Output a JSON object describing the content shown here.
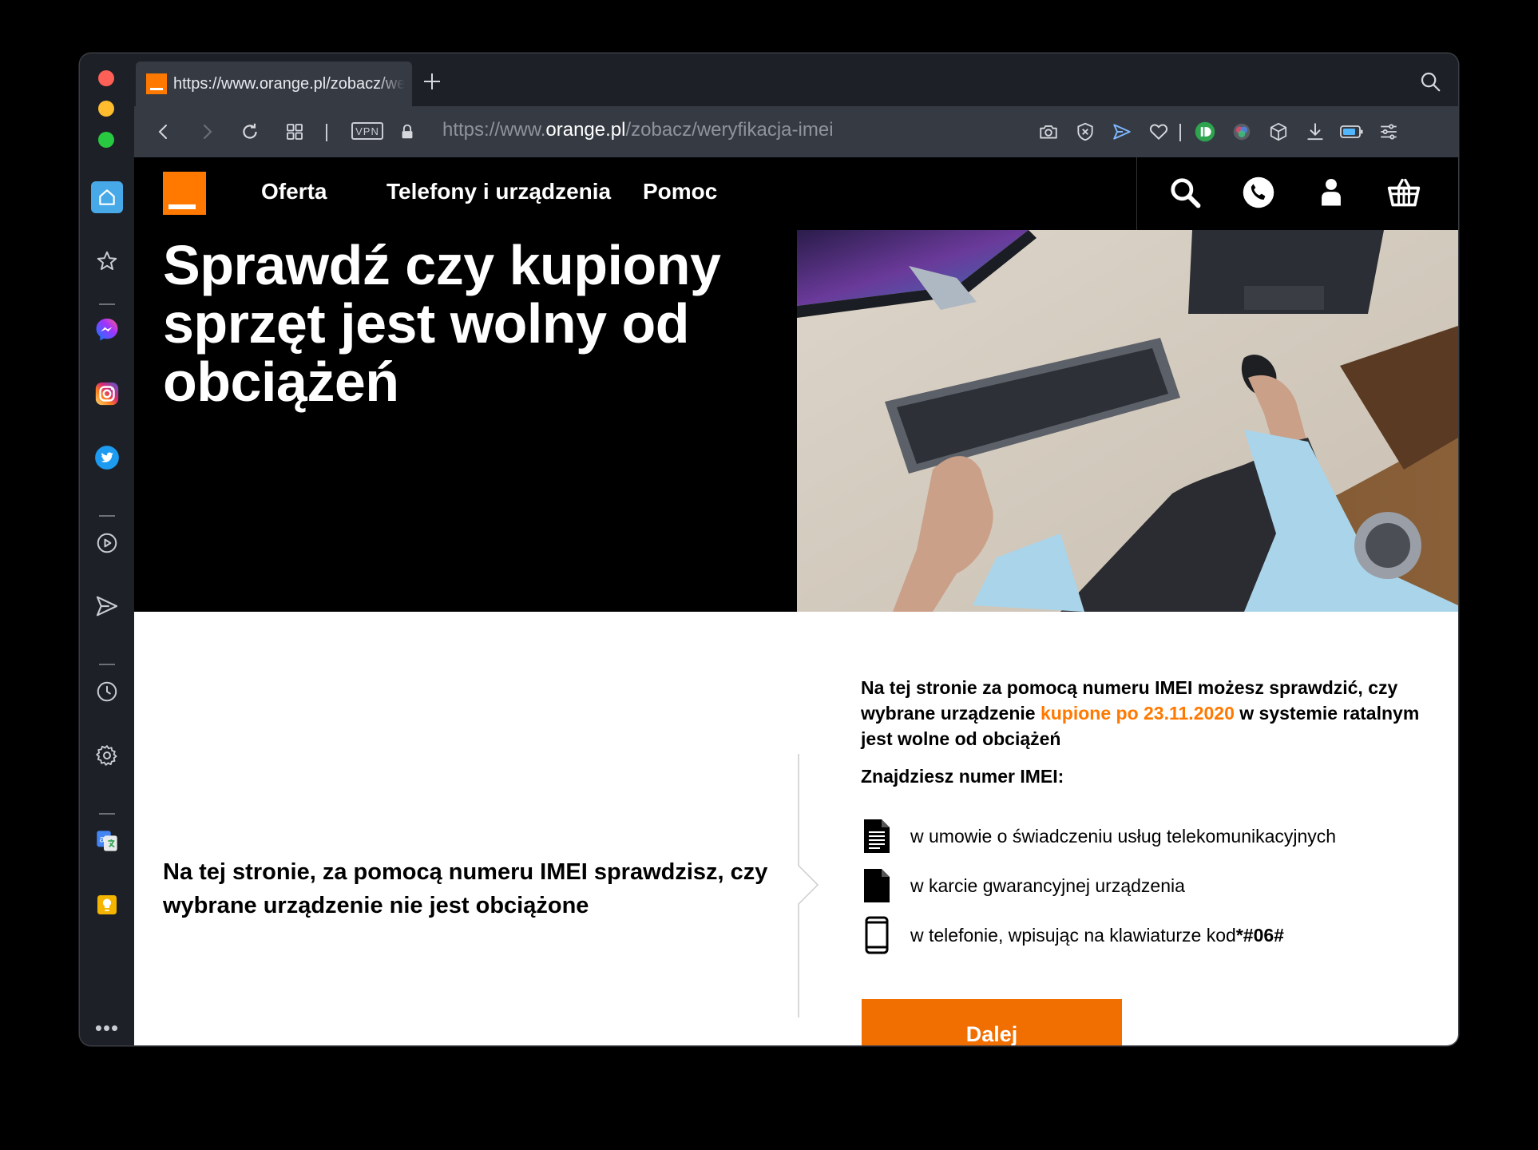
{
  "browser": {
    "tab_title": "https://www.orange.pl/zobacz/weryfikacja-imei",
    "url_prefix": "https://www.",
    "url_host": "orange.pl",
    "url_path": "/zobacz/weryfikacja-imei",
    "vpn_label": "VPN"
  },
  "nav": {
    "links": [
      "Oferta",
      "Telefony i urządzenia",
      "Pomoc"
    ]
  },
  "hero": {
    "title": "Sprawdź czy kupiony sprzęt jest wolny od obciążeń"
  },
  "intro": {
    "text": "Na tej stronie, za pomocą numeru IMEI sprawdzisz, czy wybrane urządzenie nie jest obciążone"
  },
  "info": {
    "desc_part1": "Na tej stronie za pomocą numeru IMEI możesz sprawdzić, czy wybrane urządzenie ",
    "desc_accent": "kupione po 23.11.2020",
    "desc_part2": " w systemie ratalnym jest wolne od obciążeń",
    "find_heading": "Znajdziesz numer IMEI:",
    "items": [
      {
        "text": "w umowie o świadczeniu usług telekomunikacyjnych",
        "icon": "document-icon"
      },
      {
        "text": "w karcie gwarancyjnej urządzenia",
        "icon": "file-icon"
      },
      {
        "text": "w telefonie, wpisując na klawiaturze kod",
        "code": "*#06#",
        "icon": "phone-icon"
      }
    ],
    "button_label": "Dalej"
  },
  "colors": {
    "brand_orange": "#ff7900",
    "button_orange": "#f16e00",
    "browser_dark": "#1d2027",
    "toolbar": "#363a43"
  }
}
